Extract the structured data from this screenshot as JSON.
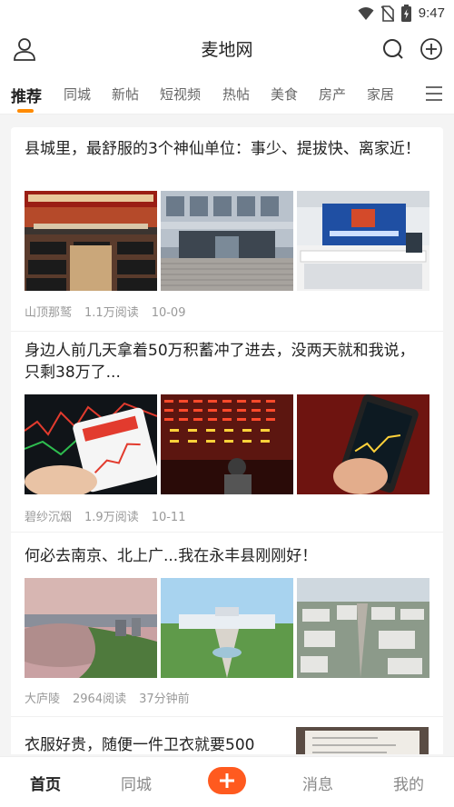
{
  "status_bar": {
    "time": "9:47",
    "icons": [
      "wifi-icon",
      "no-sim-icon",
      "battery-charging-icon"
    ]
  },
  "header": {
    "title": "麦地网",
    "icons": [
      "user-icon",
      "search-icon",
      "add-circle-icon"
    ]
  },
  "tabs": [
    "推荐",
    "同城",
    "新帖",
    "短视频",
    "热帖",
    "美食",
    "房产",
    "家居"
  ],
  "active_tab": "推荐",
  "colors": {
    "accent": "#ff8a00",
    "post_button": "#ff5a1f",
    "meta_text": "#999999"
  },
  "articles": [
    {
      "title": "县城里，最舒服的3个神仙单位：事少、提拔快、离家近！",
      "author": "山顶那鹫",
      "reads": "1.1万阅读",
      "time": "10-09",
      "thumb_icons": [
        "meeting-hall-photo",
        "government-building-photo",
        "service-counter-photo"
      ]
    },
    {
      "title": "身边人前几天拿着50万积蓄冲了进去，没两天就和我说，只剩38万了...",
      "author": "碧纱沉烟",
      "reads": "1.9万阅读",
      "time": "10-11",
      "thumb_icons": [
        "phone-stock-chart-photo",
        "stock-board-photo",
        "hand-phone-chart-photo"
      ]
    },
    {
      "title": "何必去南京、北上广...我在永丰县刚刚好！",
      "author": "大庐陵",
      "reads": "2964阅读",
      "time": "37分钟前",
      "thumb_icons": [
        "riverside-city-photo",
        "city-square-photo",
        "aerial-city-photo"
      ]
    },
    {
      "title": "衣服好贵，随便一件卫衣就要500",
      "thumb_icons": [
        "clothing-label-photo"
      ]
    }
  ],
  "bottom_nav": {
    "home": "首页",
    "local": "同城",
    "post": "+",
    "messages": "消息",
    "mine": "我的"
  }
}
